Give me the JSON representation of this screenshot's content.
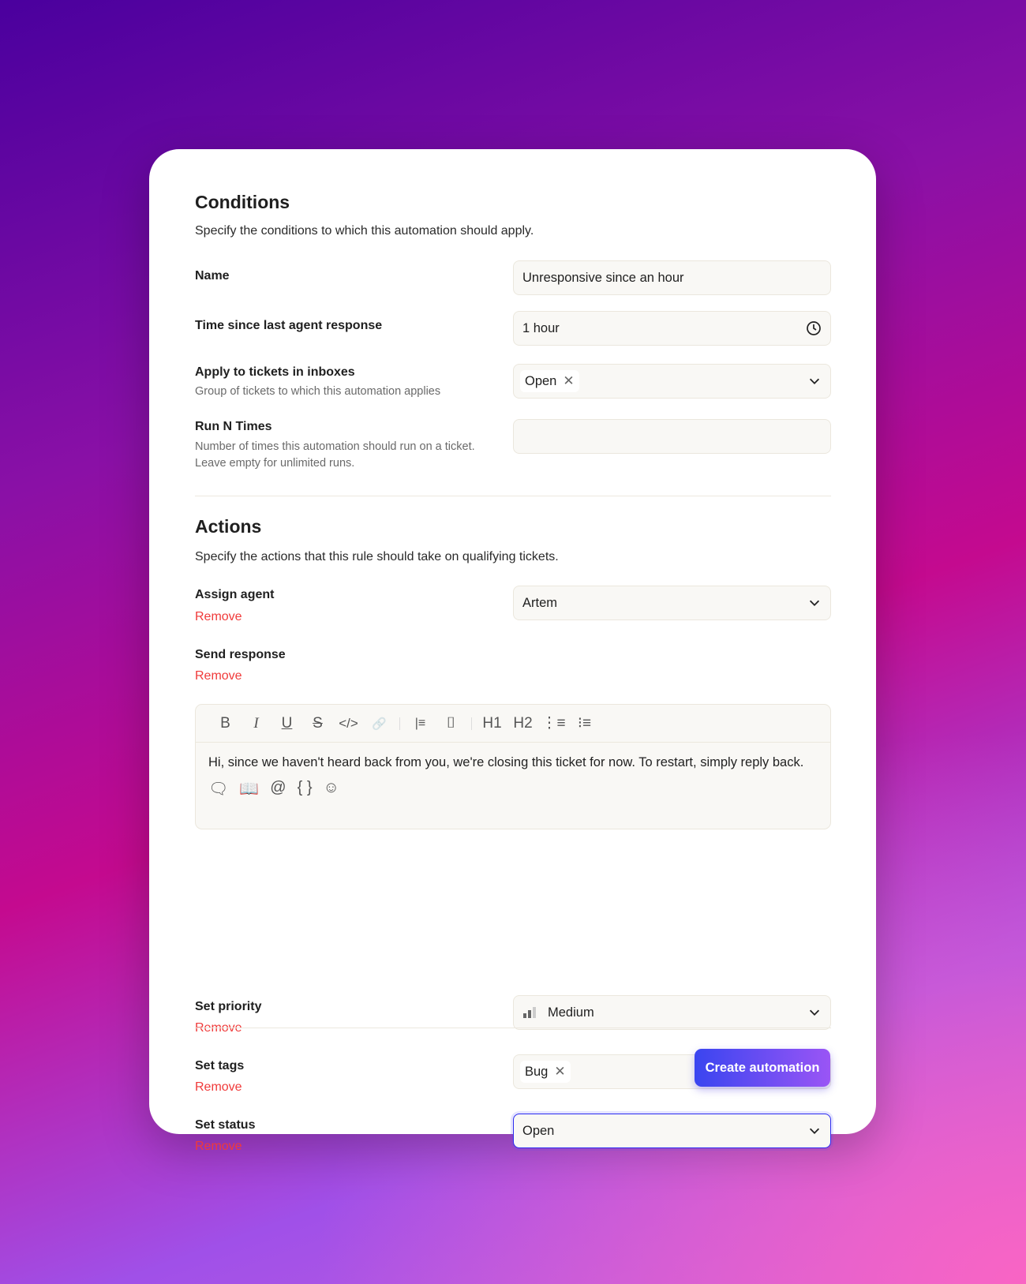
{
  "conditions": {
    "title": "Conditions",
    "subtitle": "Specify the conditions to which this automation should apply.",
    "name_label": "Name",
    "name_value": "Unresponsive since an hour",
    "time_label": "Time since last agent response",
    "time_value": "1 hour",
    "inbox_label": "Apply to tickets in inboxes",
    "inbox_hint": "Group of tickets to which this automation applies",
    "inbox_chip": "Open",
    "run_label": "Run N Times",
    "run_hint": "Number of times this automation should run on a ticket. Leave empty for unlimited runs.",
    "run_value": ""
  },
  "actions": {
    "title": "Actions",
    "subtitle": "Specify the actions that this rule should take on qualifying tickets.",
    "remove_label": "Remove",
    "assign_label": "Assign agent",
    "assign_value": "Artem",
    "response_label": "Send response",
    "response_text": "Hi, since we haven't heard back from you, we're closing this ticket for now. To restart, simply reply back.",
    "priority_label": "Set priority",
    "priority_value": "Medium",
    "tags_label": "Set tags",
    "tags_chip": "Bug",
    "status_label": "Set status",
    "status_value": "Open"
  },
  "toolbar": {
    "bold": "B",
    "italic": "I",
    "underline": "U",
    "strike": "S",
    "code": "</>",
    "link": "🔗",
    "quote": "|≡",
    "codeblock": "⌷",
    "h1": "H1",
    "h2": "H2",
    "ol": "⋮≡",
    "ul": "⁝≡"
  },
  "editor_icons": [
    "comment-plus-icon",
    "book-icon",
    "at-icon",
    "braces-icon",
    "emoji-plus-icon"
  ],
  "footer": {
    "create_label": "Create automation"
  },
  "colors": {
    "accent": "#3a45f0",
    "remove": "#f03a3a",
    "focus": "#2b2bf0"
  }
}
